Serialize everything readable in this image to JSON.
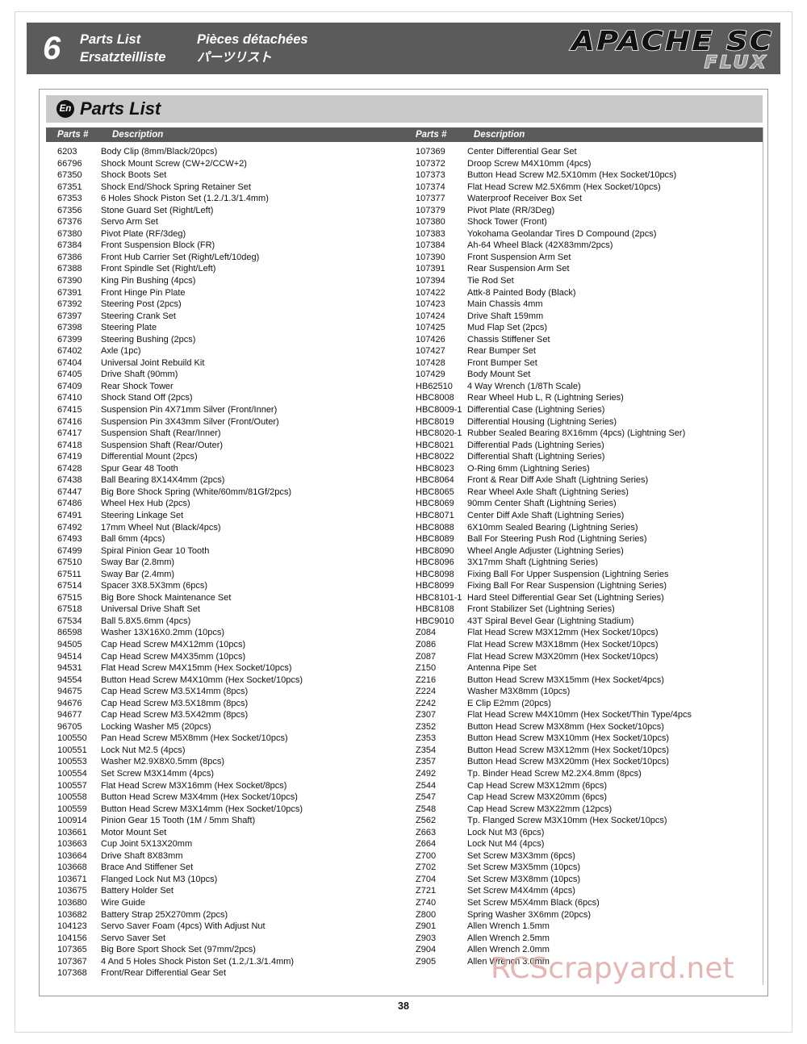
{
  "header": {
    "chapter_number": "6",
    "title_en": "Parts List",
    "title_fr": "Pièces détachées",
    "title_de": "Ersatzteilliste",
    "title_jp": "パーツリスト",
    "logo_main": "APACHE SC",
    "logo_sub": "FLUX"
  },
  "section": {
    "lang_badge": "En",
    "title": "Parts List"
  },
  "table_headers": {
    "parts_number": "Parts #",
    "description": "Description"
  },
  "watermark": "RCScrapyard.net",
  "page_number": "38",
  "colors": {
    "banner_gray": "#5b5b5b",
    "section_gray": "#c9c9c9",
    "watermark_pink": "#e0aaa6"
  },
  "left_column": [
    {
      "pn": "6203",
      "desc": "Body Clip (8mm/Black/20pcs)"
    },
    {
      "pn": "66796",
      "desc": "Shock Mount Screw (CW+2/CCW+2)"
    },
    {
      "pn": "67350",
      "desc": "Shock Boots Set"
    },
    {
      "pn": "67351",
      "desc": "Shock End/Shock Spring Retainer Set"
    },
    {
      "pn": "67353",
      "desc": "6 Holes Shock Piston Set (1.2./1.3/1.4mm)"
    },
    {
      "pn": "67356",
      "desc": "Stone Guard Set (Right/Left)"
    },
    {
      "pn": "67376",
      "desc": "Servo Arm Set"
    },
    {
      "pn": "67380",
      "desc": "Pivot Plate (RF/3deg)"
    },
    {
      "pn": "67384",
      "desc": "Front Suspension Block (FR)"
    },
    {
      "pn": "67386",
      "desc": "Front Hub Carrier Set (Right/Left/10deg)"
    },
    {
      "pn": "67388",
      "desc": "Front Spindle Set (Right/Left)"
    },
    {
      "pn": "67390",
      "desc": "King Pin Bushing (4pcs)"
    },
    {
      "pn": "67391",
      "desc": "Front Hinge Pin Plate"
    },
    {
      "pn": "67392",
      "desc": "Steering Post (2pcs)"
    },
    {
      "pn": "67397",
      "desc": "Steering Crank Set"
    },
    {
      "pn": "67398",
      "desc": "Steering Plate"
    },
    {
      "pn": "67399",
      "desc": "Steering Bushing (2pcs)"
    },
    {
      "pn": "67402",
      "desc": "Axle (1pc)"
    },
    {
      "pn": "67404",
      "desc": "Universal Joint Rebuild Kit"
    },
    {
      "pn": "67405",
      "desc": "Drive Shaft (90mm)"
    },
    {
      "pn": "67409",
      "desc": "Rear Shock Tower"
    },
    {
      "pn": "67410",
      "desc": "Shock Stand Off (2pcs)"
    },
    {
      "pn": "67415",
      "desc": "Suspension Pin 4X71mm Silver (Front/Inner)"
    },
    {
      "pn": "67416",
      "desc": "Suspension Pin 3X43mm Silver (Front/Outer)"
    },
    {
      "pn": "67417",
      "desc": "Suspension Shaft (Rear/Inner)"
    },
    {
      "pn": "67418",
      "desc": "Suspension Shaft (Rear/Outer)"
    },
    {
      "pn": "67419",
      "desc": "Differential Mount (2pcs)"
    },
    {
      "pn": "67428",
      "desc": "Spur Gear 48 Tooth"
    },
    {
      "pn": "67438",
      "desc": "Ball Bearing 8X14X4mm (2pcs)"
    },
    {
      "pn": "67447",
      "desc": "Big Bore Shock Spring (White/60mm/81Gf/2pcs)"
    },
    {
      "pn": "67486",
      "desc": "Wheel Hex Hub (2pcs)"
    },
    {
      "pn": "67491",
      "desc": "Steering Linkage Set"
    },
    {
      "pn": "67492",
      "desc": "17mm Wheel Nut (Black/4pcs)"
    },
    {
      "pn": "67493",
      "desc": "Ball 6mm (4pcs)"
    },
    {
      "pn": "67499",
      "desc": "Spiral Pinion Gear 10 Tooth"
    },
    {
      "pn": "67510",
      "desc": "Sway Bar (2.8mm)"
    },
    {
      "pn": "67511",
      "desc": "Sway Bar (2.4mm)"
    },
    {
      "pn": "67514",
      "desc": "Spacer 3X8.5X3mm (6pcs)"
    },
    {
      "pn": "67515",
      "desc": "Big Bore Shock Maintenance Set"
    },
    {
      "pn": "67518",
      "desc": "Universal Drive Shaft Set"
    },
    {
      "pn": "67534",
      "desc": "Ball 5.8X5.6mm (4pcs)"
    },
    {
      "pn": "86598",
      "desc": "Washer 13X16X0.2mm (10pcs)"
    },
    {
      "pn": "94505",
      "desc": "Cap Head Screw M4X12mm (10pcs)"
    },
    {
      "pn": "94514",
      "desc": "Cap Head Screw M4X35mm (10pcs)"
    },
    {
      "pn": "94531",
      "desc": "Flat Head Screw M4X15mm (Hex Socket/10pcs)"
    },
    {
      "pn": "94554",
      "desc": "Button Head Screw M4X10mm (Hex Socket/10pcs)"
    },
    {
      "pn": "94675",
      "desc": "Cap Head Screw M3.5X14mm (8pcs)"
    },
    {
      "pn": "94676",
      "desc": "Cap Head Screw M3.5X18mm (8pcs)"
    },
    {
      "pn": "94677",
      "desc": "Cap Head Screw M3.5X42mm (8pcs)"
    },
    {
      "pn": "96705",
      "desc": "Locking Washer M5 (20pcs)"
    },
    {
      "pn": "100550",
      "desc": "Pan Head Screw M5X8mm (Hex Socket/10pcs)"
    },
    {
      "pn": "100551",
      "desc": "Lock Nut M2.5 (4pcs)"
    },
    {
      "pn": "100553",
      "desc": "Washer M2.9X8X0.5mm (8pcs)"
    },
    {
      "pn": "100554",
      "desc": "Set Screw M3X14mm (4pcs)"
    },
    {
      "pn": "100557",
      "desc": "Flat Head Screw M3X16mm (Hex Socket/8pcs)"
    },
    {
      "pn": "100558",
      "desc": "Button Head Screw M3X4mm (Hex Socket/10pcs)"
    },
    {
      "pn": "100559",
      "desc": "Button Head Screw M3X14mm (Hex Socket/10pcs)"
    },
    {
      "pn": "100914",
      "desc": "Pinion Gear 15 Tooth (1M / 5mm Shaft)"
    },
    {
      "pn": "103661",
      "desc": "Motor Mount Set"
    },
    {
      "pn": "103663",
      "desc": "Cup Joint 5X13X20mm"
    },
    {
      "pn": "103664",
      "desc": "Drive Shaft 8X83mm"
    },
    {
      "pn": "103668",
      "desc": "Brace And Stiffener Set"
    },
    {
      "pn": "103671",
      "desc": "Flanged Lock Nut M3 (10pcs)"
    },
    {
      "pn": "103675",
      "desc": "Battery Holder Set"
    },
    {
      "pn": "103680",
      "desc": "Wire Guide"
    },
    {
      "pn": "103682",
      "desc": "Battery Strap 25X270mm (2pcs)"
    },
    {
      "pn": "104123",
      "desc": "Servo Saver Foam (4pcs) With Adjust Nut"
    },
    {
      "pn": "104156",
      "desc": "Servo Saver Set"
    },
    {
      "pn": "107365",
      "desc": "Big Bore Sport Shock Set (97mm/2pcs)"
    },
    {
      "pn": "107367",
      "desc": "4 And 5 Holes Shock Piston Set (1.2,/1.3/1.4mm)"
    },
    {
      "pn": "107368",
      "desc": "Front/Rear Differential Gear Set"
    }
  ],
  "right_column": [
    {
      "pn": "107369",
      "desc": "Center Differential Gear Set"
    },
    {
      "pn": "107372",
      "desc": "Droop Screw M4X10mm (4pcs)"
    },
    {
      "pn": "107373",
      "desc": "Button Head Screw M2.5X10mm (Hex Socket/10pcs)"
    },
    {
      "pn": "107374",
      "desc": "Flat Head Screw M2.5X6mm (Hex Socket/10pcs)"
    },
    {
      "pn": "107377",
      "desc": "Waterproof Receiver Box Set"
    },
    {
      "pn": "107379",
      "desc": "Pivot Plate (RR/3Deg)"
    },
    {
      "pn": "107380",
      "desc": "Shock Tower (Front)"
    },
    {
      "pn": "107383",
      "desc": "Yokohama Geolandar Tires D Compound (2pcs)"
    },
    {
      "pn": "107384",
      "desc": "Ah-64 Wheel Black (42X83mm/2pcs)"
    },
    {
      "pn": "107390",
      "desc": "Front Suspension Arm Set"
    },
    {
      "pn": "107391",
      "desc": "Rear Suspension Arm Set"
    },
    {
      "pn": "107394",
      "desc": "Tie Rod Set"
    },
    {
      "pn": "107422",
      "desc": "Attk-8 Painted Body (Black)"
    },
    {
      "pn": "107423",
      "desc": "Main Chassis 4mm"
    },
    {
      "pn": "107424",
      "desc": "Drive Shaft 159mm"
    },
    {
      "pn": "107425",
      "desc": "Mud Flap Set (2pcs)"
    },
    {
      "pn": "107426",
      "desc": "Chassis Stiffener Set"
    },
    {
      "pn": "107427",
      "desc": "Rear Bumper Set"
    },
    {
      "pn": "107428",
      "desc": "Front Bumper Set"
    },
    {
      "pn": "107429",
      "desc": "Body Mount Set"
    },
    {
      "pn": "HB62510",
      "desc": "4 Way Wrench (1/8Th Scale)"
    },
    {
      "pn": "HBC8008",
      "desc": "Rear Wheel Hub L, R (Lightning Series)"
    },
    {
      "pn": "HBC8009-1",
      "desc": "Differential Case (Lightning Series)"
    },
    {
      "pn": "HBC8019",
      "desc": "Differential Housing (Lightning Series)"
    },
    {
      "pn": "HBC8020-1",
      "desc": "Rubber Sealed Bearing 8X16mm (4pcs) (Lightning Ser)"
    },
    {
      "pn": "HBC8021",
      "desc": "Differential Pads (Lightning Series)"
    },
    {
      "pn": "HBC8022",
      "desc": "Differential Shaft (Lightning Series)"
    },
    {
      "pn": "HBC8023",
      "desc": "O-Ring 6mm (Lightning Series)"
    },
    {
      "pn": "HBC8064",
      "desc": "Front & Rear Diff Axle Shaft (Lightning Series)"
    },
    {
      "pn": "HBC8065",
      "desc": "Rear Wheel Axle Shaft (Lightning Series)"
    },
    {
      "pn": "HBC8069",
      "desc": "90mm Center Shaft (Lightning Series)"
    },
    {
      "pn": "HBC8071",
      "desc": "Center Diff Axle Shaft (Lightning Series)"
    },
    {
      "pn": "HBC8088",
      "desc": "6X10mm Sealed Bearing (Lightning Series)"
    },
    {
      "pn": "HBC8089",
      "desc": "Ball For Steering Push Rod (Lightning Series)"
    },
    {
      "pn": "HBC8090",
      "desc": "Wheel Angle Adjuster (Lightning Series)"
    },
    {
      "pn": "HBC8096",
      "desc": "3X17mm Shaft (Lightning Series)"
    },
    {
      "pn": "HBC8098",
      "desc": "Fixing Ball For Upper Suspension (Lightning Series"
    },
    {
      "pn": "HBC8099",
      "desc": "Fixing Ball For Rear Suspension (Lightning Series)"
    },
    {
      "pn": "HBC8101-1",
      "desc": "Hard Steel Differential Gear Set (Lightning Series)"
    },
    {
      "pn": "HBC8108",
      "desc": "Front Stabilizer Set  (Lightning Series)"
    },
    {
      "pn": "HBC9010",
      "desc": "43T Spiral Bevel Gear (Lightning Stadium)"
    },
    {
      "pn": "Z084",
      "desc": "Flat Head Screw M3X12mm (Hex Socket/10pcs)"
    },
    {
      "pn": "Z086",
      "desc": "Flat Head Screw M3X18mm (Hex Socket/10pcs)"
    },
    {
      "pn": "Z087",
      "desc": "Flat Head Screw M3X20mm (Hex Socket/10pcs)"
    },
    {
      "pn": "Z150",
      "desc": "Antenna Pipe Set"
    },
    {
      "pn": "Z216",
      "desc": "Button Head Screw M3X15mm (Hex Socket/4pcs)"
    },
    {
      "pn": "Z224",
      "desc": "Washer M3X8mm (10pcs)"
    },
    {
      "pn": "Z242",
      "desc": "E Clip E2mm (20pcs)"
    },
    {
      "pn": "Z307",
      "desc": "Flat Head Screw M4X10mm (Hex Socket/Thin Type/4pcs"
    },
    {
      "pn": "Z352",
      "desc": "Button Head Screw M3X8mm (Hex Socket/10pcs)"
    },
    {
      "pn": "Z353",
      "desc": "Button Head Screw M3X10mm (Hex Socket/10pcs)"
    },
    {
      "pn": "Z354",
      "desc": "Button Head Screw M3X12mm (Hex Socket/10pcs)"
    },
    {
      "pn": "Z357",
      "desc": "Button Head Screw M3X20mm (Hex Socket/10pcs)"
    },
    {
      "pn": "Z492",
      "desc": "Tp. Binder Head Screw M2.2X4.8mm (8pcs)"
    },
    {
      "pn": "Z544",
      "desc": "Cap Head Screw M3X12mm (6pcs)"
    },
    {
      "pn": "Z547",
      "desc": "Cap Head Screw M3X20mm (6pcs)"
    },
    {
      "pn": "Z548",
      "desc": "Cap Head Screw M3X22mm (12pcs)"
    },
    {
      "pn": "Z562",
      "desc": "Tp. Flanged Screw M3X10mm (Hex Socket/10pcs)"
    },
    {
      "pn": "Z663",
      "desc": "Lock Nut M3 (6pcs)"
    },
    {
      "pn": "Z664",
      "desc": "Lock Nut M4 (4pcs)"
    },
    {
      "pn": "Z700",
      "desc": "Set Screw M3X3mm (6pcs)"
    },
    {
      "pn": "Z702",
      "desc": "Set Screw M3X5mm (10pcs)"
    },
    {
      "pn": "Z704",
      "desc": "Set Screw M3X8mm (10pcs)"
    },
    {
      "pn": "Z721",
      "desc": "Set Screw M4X4mm (4pcs)"
    },
    {
      "pn": "Z740",
      "desc": "Set Screw M5X4mm Black (6pcs)"
    },
    {
      "pn": "Z800",
      "desc": "Spring Washer 3X6mm (20pcs)"
    },
    {
      "pn": "Z901",
      "desc": "Allen Wrench 1.5mm"
    },
    {
      "pn": "Z903",
      "desc": "Allen Wrench 2.5mm"
    },
    {
      "pn": "Z904",
      "desc": "Allen Wrench 2.0mm"
    },
    {
      "pn": "Z905",
      "desc": "Allen Wrench 3.0mm"
    }
  ]
}
